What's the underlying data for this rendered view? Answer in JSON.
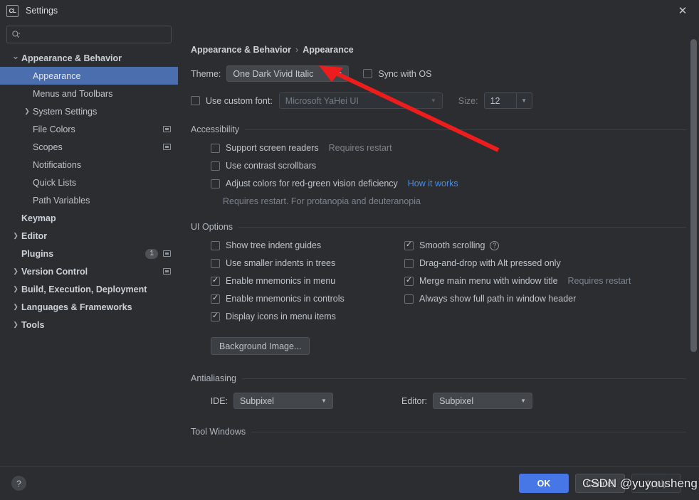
{
  "window": {
    "title": "Settings",
    "app_icon": "clion-icon",
    "close_icon": "close-icon",
    "accent_color": "#4777e6",
    "selection_color": "#4b6eaf",
    "annotation_color": "#ee1d1d"
  },
  "sidebar": {
    "search": {
      "placeholder": "",
      "value": "",
      "icon": "search-icon"
    },
    "items": [
      {
        "label": "Appearance & Behavior",
        "arrow": "chevron-down-icon",
        "indent": 0,
        "selected": false,
        "bold": true,
        "badge": "",
        "cfg": false
      },
      {
        "label": "Appearance",
        "arrow": "",
        "indent": 1,
        "selected": true,
        "bold": false,
        "badge": "",
        "cfg": false
      },
      {
        "label": "Menus and Toolbars",
        "arrow": "",
        "indent": 1,
        "selected": false,
        "bold": false,
        "badge": "",
        "cfg": false
      },
      {
        "label": "System Settings",
        "arrow": "chevron-right-icon",
        "indent": 1,
        "selected": false,
        "bold": false,
        "badge": "",
        "cfg": false
      },
      {
        "label": "File Colors",
        "arrow": "",
        "indent": 1,
        "selected": false,
        "bold": false,
        "badge": "",
        "cfg": true
      },
      {
        "label": "Scopes",
        "arrow": "",
        "indent": 1,
        "selected": false,
        "bold": false,
        "badge": "",
        "cfg": true
      },
      {
        "label": "Notifications",
        "arrow": "",
        "indent": 1,
        "selected": false,
        "bold": false,
        "badge": "",
        "cfg": false
      },
      {
        "label": "Quick Lists",
        "arrow": "",
        "indent": 1,
        "selected": false,
        "bold": false,
        "badge": "",
        "cfg": false
      },
      {
        "label": "Path Variables",
        "arrow": "",
        "indent": 1,
        "selected": false,
        "bold": false,
        "badge": "",
        "cfg": false
      },
      {
        "label": "Keymap",
        "arrow": "",
        "indent": 0,
        "selected": false,
        "bold": true,
        "badge": "",
        "cfg": false
      },
      {
        "label": "Editor",
        "arrow": "chevron-right-icon",
        "indent": 0,
        "selected": false,
        "bold": true,
        "badge": "",
        "cfg": false
      },
      {
        "label": "Plugins",
        "arrow": "",
        "indent": 0,
        "selected": false,
        "bold": true,
        "badge": "1",
        "cfg": true
      },
      {
        "label": "Version Control",
        "arrow": "chevron-right-icon",
        "indent": 0,
        "selected": false,
        "bold": true,
        "badge": "",
        "cfg": true
      },
      {
        "label": "Build, Execution, Deployment",
        "arrow": "chevron-right-icon",
        "indent": 0,
        "selected": false,
        "bold": true,
        "badge": "",
        "cfg": false
      },
      {
        "label": "Languages & Frameworks",
        "arrow": "chevron-right-icon",
        "indent": 0,
        "selected": false,
        "bold": true,
        "badge": "",
        "cfg": false
      },
      {
        "label": "Tools",
        "arrow": "chevron-right-icon",
        "indent": 0,
        "selected": false,
        "bold": true,
        "badge": "",
        "cfg": false
      }
    ]
  },
  "content": {
    "breadcrumb": {
      "parent": "Appearance & Behavior",
      "separator": "›",
      "current": "Appearance"
    },
    "theme": {
      "label": "Theme:",
      "value": "One Dark Vivid Italic",
      "sync_label": "Sync with OS",
      "sync_checked": false
    },
    "font": {
      "custom_label": "Use custom font:",
      "custom_checked": false,
      "value": "Microsoft YaHei UI",
      "size_label": "Size:",
      "size_value": "12"
    },
    "accessibility": {
      "title": "Accessibility",
      "options": [
        {
          "label": "Support screen readers",
          "checked": false,
          "note": "Requires restart",
          "link": ""
        },
        {
          "label": "Use contrast scrollbars",
          "checked": false,
          "note": "",
          "link": ""
        },
        {
          "label": "Adjust colors for red-green vision deficiency",
          "checked": false,
          "note": "",
          "link": "How it works"
        }
      ],
      "footnote": "Requires restart. For protanopia and deuteranopia"
    },
    "ui_options": {
      "title": "UI Options",
      "left": [
        {
          "label": "Show tree indent guides",
          "checked": false,
          "help": false
        },
        {
          "label": "Use smaller indents in trees",
          "checked": false,
          "help": false
        },
        {
          "label": "Enable mnemonics in menu",
          "checked": true,
          "help": false
        },
        {
          "label": "Enable mnemonics in controls",
          "checked": true,
          "help": false
        },
        {
          "label": "Display icons in menu items",
          "checked": true,
          "help": false
        }
      ],
      "right": [
        {
          "label": "Smooth scrolling",
          "checked": true,
          "help": true,
          "note": ""
        },
        {
          "label": "Drag-and-drop with Alt pressed only",
          "checked": false,
          "help": false,
          "note": ""
        },
        {
          "label": "Merge main menu with window title",
          "checked": true,
          "help": false,
          "note": "Requires restart"
        },
        {
          "label": "Always show full path in window header",
          "checked": false,
          "help": false,
          "note": ""
        }
      ],
      "background_image_button": "Background Image..."
    },
    "antialiasing": {
      "title": "Antialiasing",
      "ide_label": "IDE:",
      "ide_value": "Subpixel",
      "editor_label": "Editor:",
      "editor_value": "Subpixel"
    },
    "tool_windows": {
      "title": "Tool Windows"
    }
  },
  "footer": {
    "help_icon": "question-mark-icon",
    "ok_label": "OK",
    "cancel_label": "Cancel",
    "apply_label": "Apply"
  },
  "watermark": {
    "text": "CSDN @yuyousheng"
  }
}
